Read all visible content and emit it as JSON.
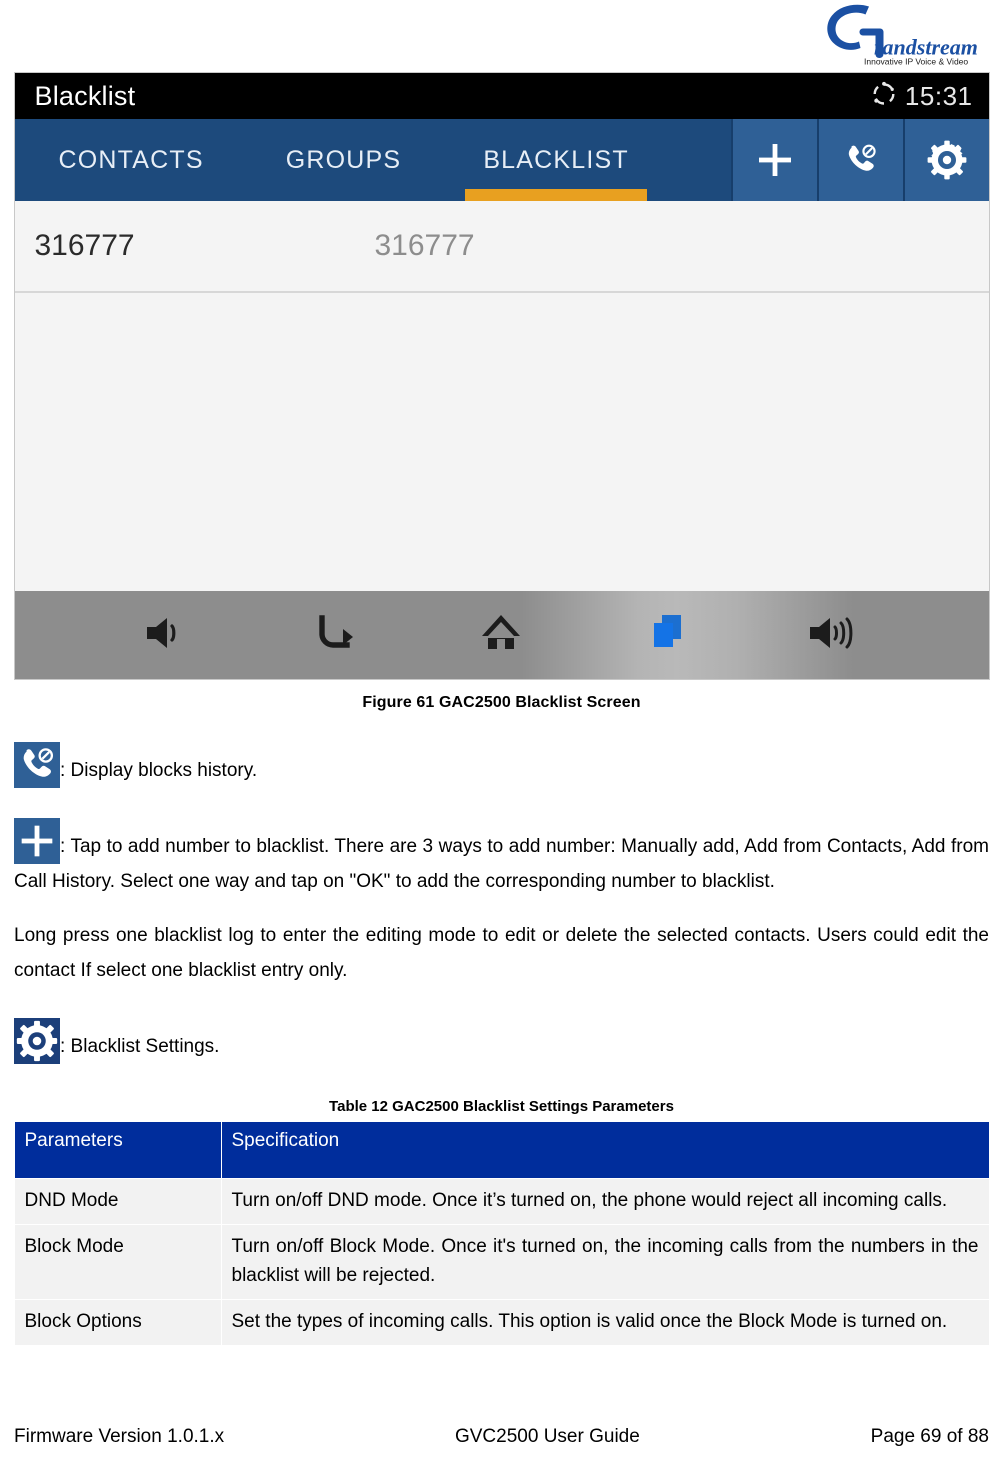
{
  "brand": {
    "logo_name": "Grandstream",
    "tagline": "Innovative IP Voice & Video"
  },
  "screenshot": {
    "status_bar": {
      "title": "Blacklist",
      "clock": "15:31",
      "sync_icon": "sync-circle-icon"
    },
    "tabs": [
      {
        "label": "CONTACTS",
        "active": false
      },
      {
        "label": "GROUPS",
        "active": false
      },
      {
        "label": "BLACKLIST",
        "active": true
      }
    ],
    "actions": [
      {
        "name": "add-blacklist-button",
        "icon": "plus-icon"
      },
      {
        "name": "blocked-calls-history-button",
        "icon": "blocked-call-icon"
      },
      {
        "name": "blacklist-settings-button",
        "icon": "gear-icon"
      }
    ],
    "list": [
      {
        "name": "316777",
        "number": "316777"
      }
    ],
    "nav_bar": [
      {
        "name": "volume-down-button",
        "icon": "volume-down-icon"
      },
      {
        "name": "back-button",
        "icon": "back-arrow-icon"
      },
      {
        "name": "home-button",
        "icon": "home-icon"
      },
      {
        "name": "recent-apps-button",
        "icon": "recent-apps-icon"
      },
      {
        "name": "volume-up-button",
        "icon": "volume-up-icon"
      }
    ],
    "accent_color": "#e8a020",
    "tab_bar_color": "#1d4a7c",
    "action_color": "#2f6096"
  },
  "figure_caption": "Figure 61 GAC2500 Blacklist Screen",
  "descriptions": {
    "blocked_history": ": Display blocks history.",
    "add_number": ": Tap to add number to blacklist. There are 3 ways to add number: Manually add, Add from Contacts, Add from Call History. Select one way and tap on \"OK\" to add the corresponding number to blacklist.",
    "long_press": "Long press one blacklist log to enter the editing mode to edit or delete the selected contacts. Users could edit the contact If select one blacklist entry only.",
    "settings": ": Blacklist Settings."
  },
  "table": {
    "caption": "Table 12 GAC2500 Blacklist Settings Parameters",
    "headers": [
      "Parameters",
      "Specification"
    ],
    "header_color": "#002d9c",
    "rows": [
      {
        "parameter": "DND Mode",
        "specification": "Turn on/off DND mode. Once it’s turned on, the phone would reject all incoming calls."
      },
      {
        "parameter": "Block Mode",
        "specification": "Turn on/off Block Mode. Once it's turned on, the incoming calls from the numbers in the blacklist will be rejected."
      },
      {
        "parameter": "Block Options",
        "specification": "Set the types of incoming calls. This option is valid once the Block Mode is turned on."
      }
    ]
  },
  "footer": {
    "left": "Firmware Version 1.0.1.x",
    "center": "GVC2500 User Guide",
    "right": "Page 69 of 88"
  }
}
